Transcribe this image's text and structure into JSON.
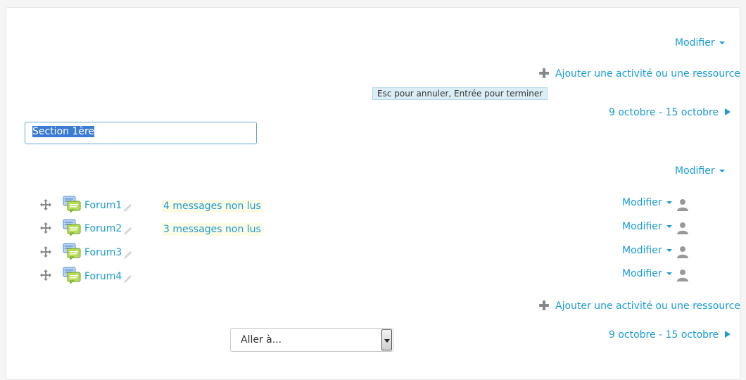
{
  "header": {
    "modifier_label": "Modifier",
    "add_activity_label": "Ajouter une activité ou une ressource",
    "edit_hint": "Esc pour annuler, Entrée pour terminer",
    "date_range": "9 octobre - 15 octobre"
  },
  "section": {
    "name_value": "Section 1ère",
    "modifier_label": "Modifier"
  },
  "activities": [
    {
      "name": "Forum1",
      "unread": "4 messages non lus",
      "modifier_label": "Modifier"
    },
    {
      "name": "Forum2",
      "unread": "3 messages non lus",
      "modifier_label": "Modifier"
    },
    {
      "name": "Forum3",
      "unread": "",
      "modifier_label": "Modifier"
    },
    {
      "name": "Forum4",
      "unread": "",
      "modifier_label": "Modifier"
    }
  ],
  "footer": {
    "add_activity_label": "Ajouter une activité ou une ressource",
    "jump_select": "Aller à...",
    "date_range": "9 octobre - 15 octobre"
  },
  "colors": {
    "link": "#1a9bd7",
    "hint_bg": "#dbeef7",
    "unread_bg": "#fcfbe3"
  },
  "icons": [
    "plus-icon",
    "move-icon",
    "forum-icon",
    "pencil-icon",
    "user-icon",
    "caret-down-icon",
    "arrow-right-icon"
  ]
}
